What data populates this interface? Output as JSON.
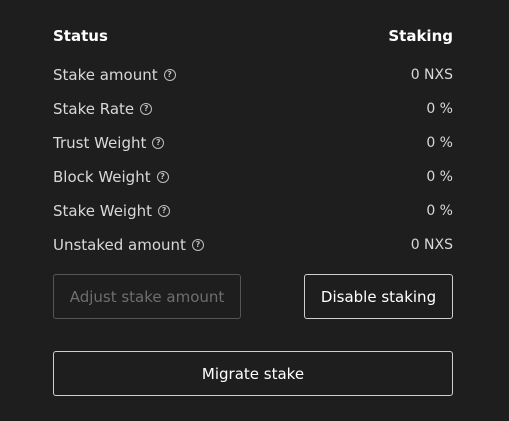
{
  "header": {
    "status_label": "Status",
    "status_value": "Staking"
  },
  "rows": [
    {
      "label": "Stake amount",
      "value": "0 NXS",
      "icon": "help-icon"
    },
    {
      "label": "Stake Rate",
      "value": "0 %",
      "icon": "help-icon"
    },
    {
      "label": "Trust Weight",
      "value": "0 %",
      "icon": "help-icon"
    },
    {
      "label": "Block Weight",
      "value": "0 %",
      "icon": "help-icon"
    },
    {
      "label": "Stake Weight",
      "value": "0 %",
      "icon": "help-icon"
    },
    {
      "label": "Unstaked amount",
      "value": "0 NXS",
      "icon": "help-icon"
    }
  ],
  "buttons": {
    "adjust_label": "Adjust stake amount",
    "disable_label": "Disable staking",
    "migrate_label": "Migrate stake"
  },
  "icon_glyph": "?"
}
